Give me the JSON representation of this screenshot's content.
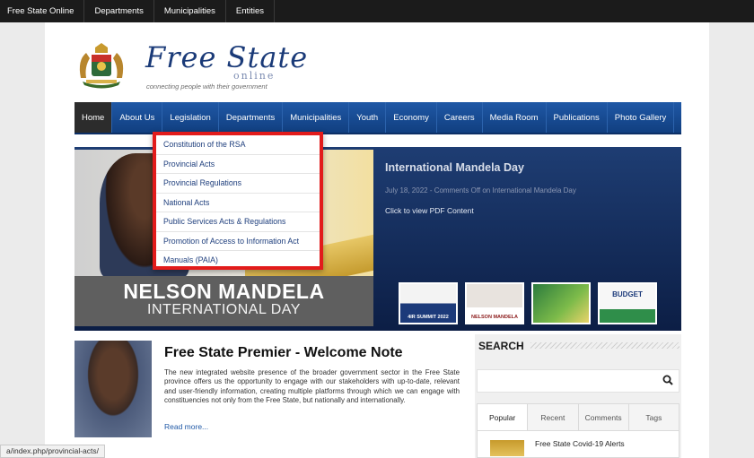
{
  "topbar": {
    "items": [
      "Free State Online",
      "Departments",
      "Municipalities",
      "Entities"
    ]
  },
  "logo": {
    "title": "Free State",
    "subtitle": "online",
    "tagline": "connecting people with their government"
  },
  "mainnav": {
    "items": [
      "Home",
      "About Us",
      "Legislation",
      "Departments",
      "Municipalities",
      "Youth",
      "Economy",
      "Careers",
      "Media Room",
      "Publications",
      "Photo Gallery"
    ],
    "active": "Home"
  },
  "dropdown": {
    "items": [
      "Constitution of the RSA",
      "Provincial Acts",
      "Provincial Regulations",
      "National Acts",
      "Public Services Acts & Regulations",
      "Promotion of Access to Information Act",
      "Manuals (PAIA)"
    ]
  },
  "slider": {
    "image_line1": "NELSON MANDELA",
    "image_line2": "INTERNATIONAL DAY",
    "title": "International Mandela Day",
    "meta": "July 18, 2022 - Comments Off on International Mandela Day",
    "link": "Click to view PDF Content",
    "thumbs": [
      {
        "label": "4IR SUMMIT 2022"
      },
      {
        "label": "NELSON MANDELA"
      },
      {
        "label": ""
      },
      {
        "label": "BUDGET"
      }
    ]
  },
  "welcome": {
    "title": "Free State Premier - Welcome Note",
    "body": "The new integrated website presence of the broader government sector in the Free State province offers us the opportunity to engage with our stakeholders with up-to-date, relevant and user-friendly information, creating multiple platforms through which we can engage with constituencies not only from the Free State, but nationally and internationally.",
    "read_more": "Read more..."
  },
  "sidebar": {
    "search_heading": "SEARCH",
    "search_value": "",
    "tabs": [
      "Popular",
      "Recent",
      "Comments",
      "Tags"
    ],
    "active_tab": "Popular",
    "popular_item": "Free State Covid-19 Alerts"
  },
  "statusbar": {
    "url": "a/index.php/provincial-acts/"
  }
}
